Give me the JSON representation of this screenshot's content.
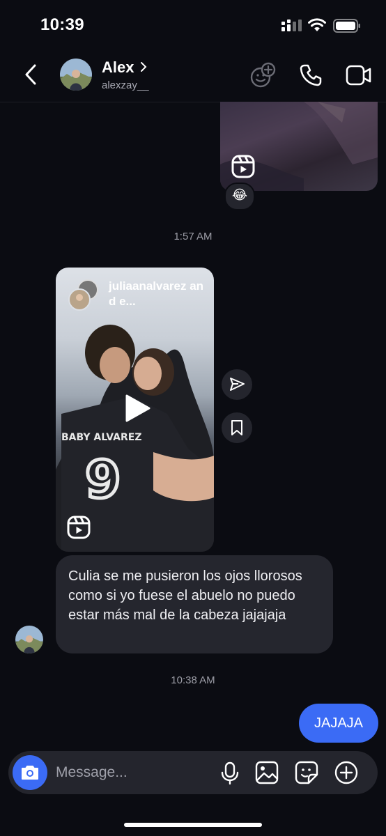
{
  "status_bar": {
    "time": "10:39"
  },
  "header": {
    "name": "Alex",
    "handle": "alexzay__"
  },
  "thread": {
    "reaction_emoji": "😂",
    "timestamp_1": "1:57 AM",
    "shared_post": {
      "username": "juliaanalvarez and e..."
    },
    "received_message": "Culia se me pusieron los ojos llorosos como si yo fuese el abuelo no puedo estar más mal de la cabeza jajajaja",
    "timestamp_2": "10:38 AM",
    "sent_message": "JAJAJA"
  },
  "composer": {
    "placeholder": "Message..."
  },
  "icons": {
    "back": "chevron-left-icon",
    "effects": "effects-icon",
    "call": "phone-icon",
    "video": "video-camera-icon",
    "reel": "reel-icon",
    "share": "send-icon",
    "save": "bookmark-icon",
    "camera": "camera-icon",
    "mic": "microphone-icon",
    "gallery": "image-icon",
    "sticker": "sticker-icon",
    "add": "plus-circle-icon"
  },
  "colors": {
    "background": "#0b0c12",
    "accent": "#3b6bf5",
    "bubble": "#25262e"
  }
}
